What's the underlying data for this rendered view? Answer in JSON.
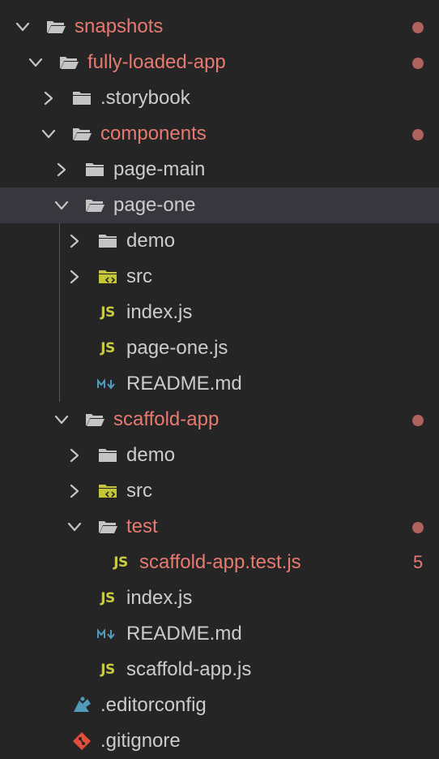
{
  "colors": {
    "background": "#252526",
    "selected_row": "#37373d",
    "text": "#cccccc",
    "modified_text": "#e67a70",
    "modified_dot": "#b0635c",
    "js_icon": "#cbcb41",
    "md_icon": "#519aba",
    "src_folder": "#c5c53a",
    "editorconfig_icon": "#519aba",
    "git_icon": "#e44d3a"
  },
  "tree": [
    {
      "label": "snapshots",
      "depth": 0,
      "kind": "folder-open",
      "chevron": "down",
      "modified": true
    },
    {
      "label": "fully-loaded-app",
      "depth": 1,
      "kind": "folder-open",
      "chevron": "down",
      "modified": true
    },
    {
      "label": ".storybook",
      "depth": 2,
      "kind": "folder",
      "chevron": "right",
      "modified": false
    },
    {
      "label": "components",
      "depth": 2,
      "kind": "folder-open",
      "chevron": "down",
      "modified": true
    },
    {
      "label": "page-main",
      "depth": 3,
      "kind": "folder",
      "chevron": "right",
      "modified": false
    },
    {
      "label": "page-one",
      "depth": 3,
      "kind": "folder-open",
      "chevron": "down",
      "modified": false,
      "selected": true
    },
    {
      "label": "demo",
      "depth": 4,
      "kind": "folder",
      "chevron": "right",
      "modified": false
    },
    {
      "label": "src",
      "depth": 4,
      "kind": "folder-src",
      "chevron": "right",
      "modified": false
    },
    {
      "label": "index.js",
      "depth": 4,
      "kind": "js",
      "modified": false
    },
    {
      "label": "page-one.js",
      "depth": 4,
      "kind": "js",
      "modified": false
    },
    {
      "label": "README.md",
      "depth": 4,
      "kind": "md",
      "modified": false
    },
    {
      "label": "scaffold-app",
      "depth": 3,
      "kind": "folder-open",
      "chevron": "down",
      "modified": true
    },
    {
      "label": "demo",
      "depth": 4,
      "kind": "folder",
      "chevron": "right",
      "modified": false
    },
    {
      "label": "src",
      "depth": 4,
      "kind": "folder-src",
      "chevron": "right",
      "modified": false
    },
    {
      "label": "test",
      "depth": 4,
      "kind": "folder-open",
      "chevron": "down",
      "modified": true
    },
    {
      "label": "scaffold-app.test.js",
      "depth": 5,
      "kind": "js",
      "modified": true,
      "problems": "5"
    },
    {
      "label": "index.js",
      "depth": 4,
      "kind": "js",
      "modified": false
    },
    {
      "label": "README.md",
      "depth": 4,
      "kind": "md",
      "modified": false
    },
    {
      "label": "scaffold-app.js",
      "depth": 4,
      "kind": "js",
      "modified": false
    },
    {
      "label": ".editorconfig",
      "depth": 2,
      "kind": "editorconfig",
      "modified": false
    },
    {
      "label": ".gitignore",
      "depth": 2,
      "kind": "git",
      "modified": false
    }
  ],
  "icon_text": {
    "js": "JS"
  }
}
